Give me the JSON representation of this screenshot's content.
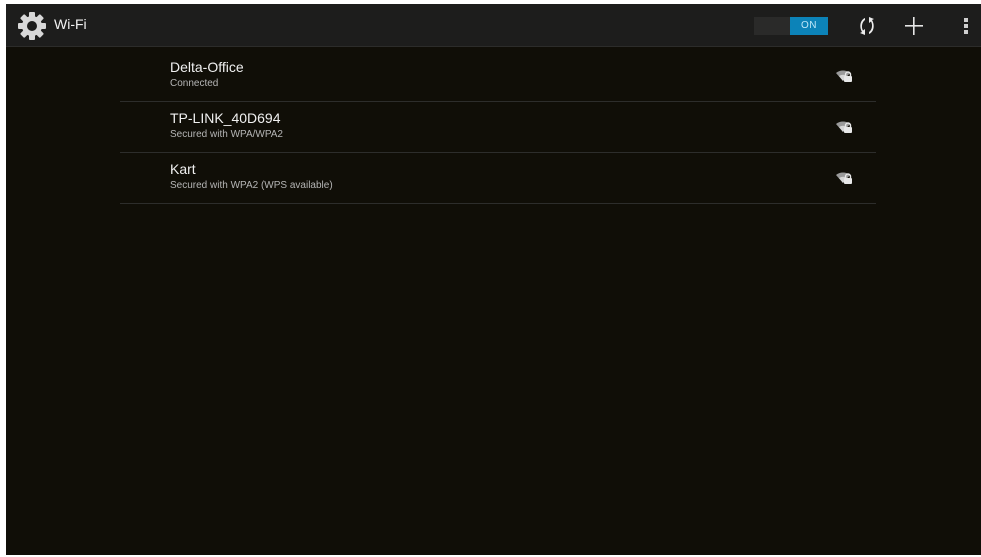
{
  "action_bar": {
    "title": "Wi-Fi",
    "toggle_label": "ON",
    "accent_color": "#0c83b8",
    "icons": {
      "app": "settings-gear-icon",
      "wps": "wps-icon",
      "add": "add-network-icon",
      "overflow": "overflow-menu-icon"
    }
  },
  "networks": [
    {
      "name": "Delta-Office",
      "status": "Connected",
      "icon": "wifi-signal-locked-icon"
    },
    {
      "name": "TP-LINK_40D694",
      "status": "Secured with WPA/WPA2",
      "icon": "wifi-signal-locked-icon"
    },
    {
      "name": "Kart",
      "status": "Secured with WPA2 (WPS available)",
      "icon": "wifi-signal-locked-icon"
    }
  ]
}
